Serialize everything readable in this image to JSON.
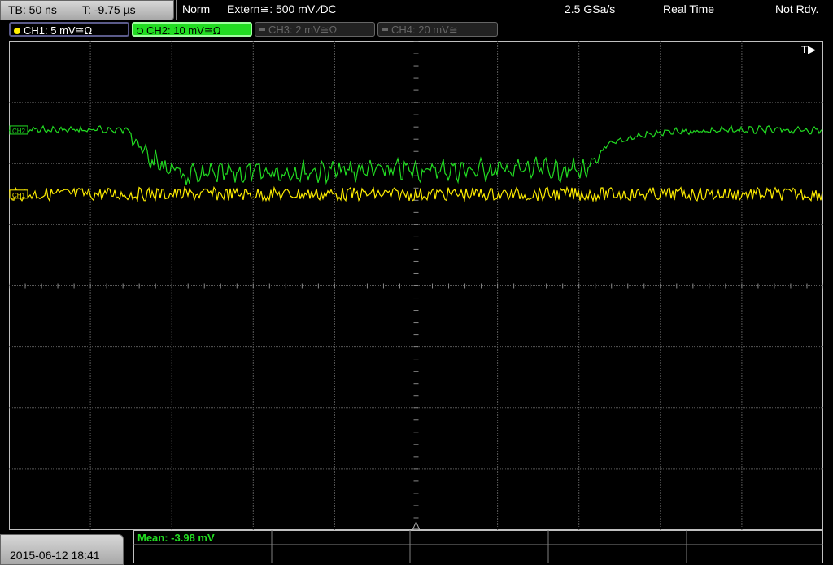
{
  "status_bar": {
    "timebase": "TB: 50 ns",
    "trigger_time": "T: -9.75 µs",
    "mode": "Norm",
    "trigger_source": "Extern≅: 500 mV ⁄DC",
    "sample_rate": "2.5 GSa/s",
    "acquisition": "Real Time",
    "ready_state": "Not Rdy."
  },
  "channels": [
    {
      "label": "CH1: 5 mV≅Ω",
      "state": "on",
      "color": "#ffee00"
    },
    {
      "label": "CH2: 10 mV≅Ω",
      "state": "selected",
      "color": "#22dd22"
    },
    {
      "label": "CH3: 2 mV≅Ω",
      "state": "off",
      "color": "#666666"
    },
    {
      "label": "CH4: 20 mV≅",
      "state": "off",
      "color": "#666666"
    }
  ],
  "screen": {
    "trigger_marker": "T▶",
    "ch2_marker": "CH2",
    "ch1_marker": "CH1"
  },
  "waveforms": {
    "ch2": {
      "color": "#22dd22",
      "description_levels_div": {
        "high": 1.45,
        "low": 2.1,
        "fall_start_div": 1.5,
        "fall_end_div": 2.1,
        "rise_start_div": 7.15,
        "rise_end_div": 7.3
      }
    },
    "ch1": {
      "color": "#ffee00",
      "level_div": 2.5
    }
  },
  "footer": {
    "datetime": "2015-06-12 18:41",
    "measurement": "Mean: -3.98 mV"
  },
  "colors": {
    "grid": "#5a5a5a",
    "ch1": "#ffee00",
    "ch2": "#22dd22"
  }
}
